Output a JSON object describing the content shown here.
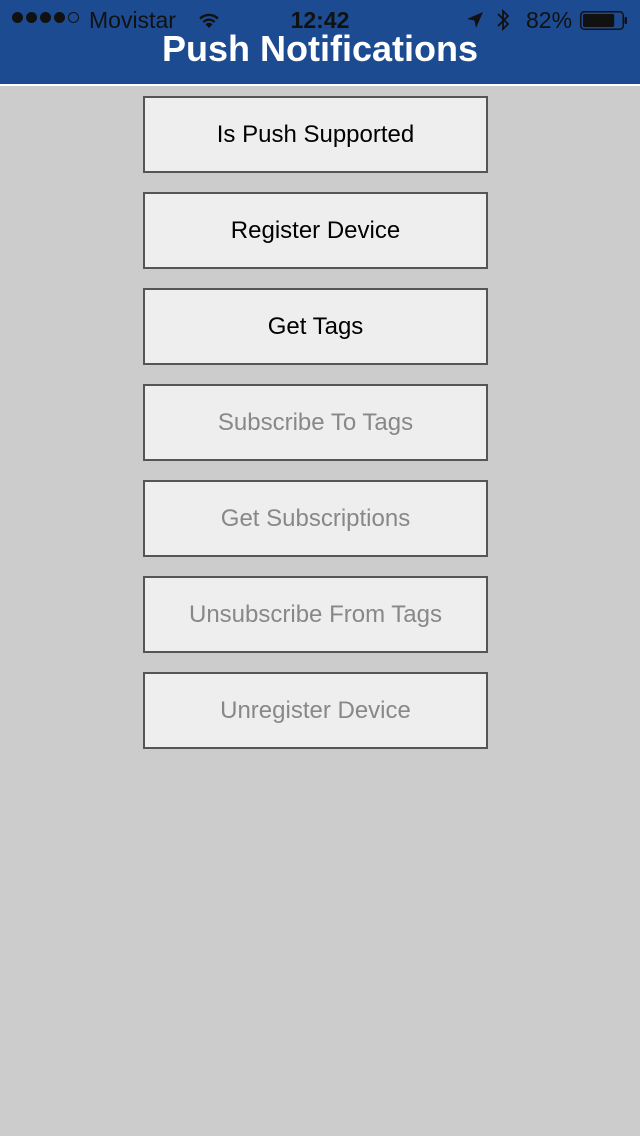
{
  "status_bar": {
    "carrier": "Movistar",
    "time": "12:42",
    "battery": "82%",
    "signal_bars_filled": 4,
    "signal_bars_total": 5,
    "battery_level": 0.82
  },
  "header": {
    "title": "Push Notifications",
    "background_color": "#1c4b91"
  },
  "buttons": [
    {
      "label": "Is Push Supported",
      "enabled": true
    },
    {
      "label": "Register Device",
      "enabled": true
    },
    {
      "label": "Get Tags",
      "enabled": true
    },
    {
      "label": "Subscribe To Tags",
      "enabled": false
    },
    {
      "label": "Get Subscriptions",
      "enabled": false
    },
    {
      "label": "Unsubscribe From Tags",
      "enabled": false
    },
    {
      "label": "Unregister Device",
      "enabled": false
    }
  ]
}
